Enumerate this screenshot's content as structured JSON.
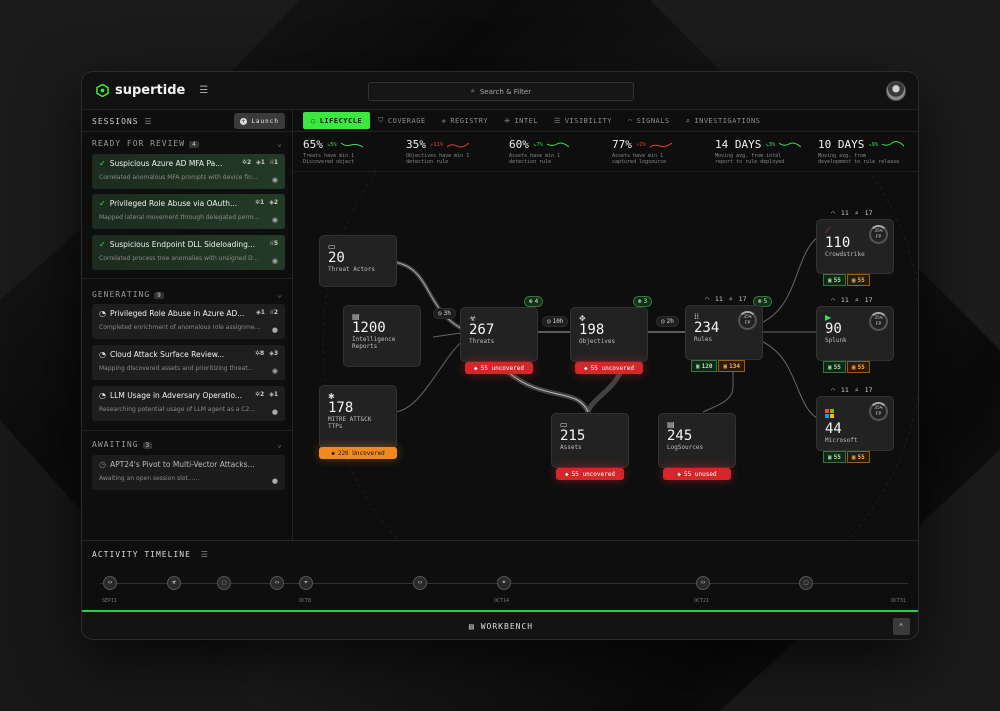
{
  "app": {
    "name": "supertide"
  },
  "search": {
    "label": "Search & Filter"
  },
  "sessions": {
    "title": "SESSIONS",
    "launch_label": "Launch"
  },
  "groups": {
    "ready": {
      "label": "READY FOR REVIEW",
      "count": "4"
    },
    "generating": {
      "label": "GENERATING",
      "count": "9"
    },
    "awaiting": {
      "label": "AWAITING",
      "count": "3"
    }
  },
  "ready_items": [
    {
      "title": "Suspicious Azure AD MFA Pa...",
      "desc": "Correlated anomalous MFA prompts with device fin...",
      "m1": "2",
      "m2": "1",
      "m3": "1"
    },
    {
      "title": "Privileged Role Abuse via OAuth...",
      "desc": "Mapped lateral movement through delegated perm...",
      "m1": "1",
      "m2": "2"
    },
    {
      "title": "Suspicious Endpoint DLL Sideloading...",
      "desc": "Correlated process tree anomalies with unsigned D...",
      "m1": "5"
    }
  ],
  "generating_items": [
    {
      "title": "Privileged Role Abuse in Azure AD...",
      "desc": "Completed enrichment of anomalous role assignme...",
      "m1": "1",
      "m2": "2"
    },
    {
      "title": "Cloud Attack Surface Review...",
      "desc": "Mapping discovered assets and prioritizing threat...",
      "m1": "8",
      "m2": "3"
    },
    {
      "title": "LLM Usage in Adversary Operatio...",
      "desc": "Researching potential usage of LLM agent as a C2...",
      "m1": "2",
      "m2": "1"
    }
  ],
  "awaiting_items": [
    {
      "title": "APT24's Pivot to Multi-Vector Attacks...",
      "desc": "Awaiting an open session slot......"
    }
  ],
  "tabs": [
    "LIFECYCLE",
    "COVERAGE",
    "REGISTRY",
    "INTEL",
    "VISIBILITY",
    "SIGNALS",
    "INVESTIGATIONS"
  ],
  "metrics": [
    {
      "value": "65%",
      "change": "5%",
      "dir": "down",
      "label1": "Treats have min 1",
      "label2": "Discovered object"
    },
    {
      "value": "35%",
      "change": "11%",
      "dir": "up",
      "label1": "Objectives have min 1",
      "label2": "detection rule"
    },
    {
      "value": "60%",
      "change": "7%",
      "dir": "down",
      "label1": "Assets have min 1",
      "label2": "detection rule"
    },
    {
      "value": "77%",
      "change": "2%",
      "dir": "up",
      "label1": "Assets have min 1",
      "label2": "captured logsource"
    },
    {
      "value": "14 DAYS",
      "change": "3%",
      "dir": "down",
      "label1": "Moving avg. from intel",
      "label2": "report to rule deployed"
    },
    {
      "value": "10 DAYS",
      "change": "9%",
      "dir": "down",
      "label1": "Moving avg. from",
      "label2": "development to rule release"
    }
  ],
  "nodes": {
    "actors": {
      "value": "20",
      "label": "Threat Actors"
    },
    "reports": {
      "value": "1200",
      "label1": "Intelligence",
      "label2": "Reports"
    },
    "ttps": {
      "value": "178",
      "label1": "MITRE ATT&CK",
      "label2": "TTPs",
      "badge": "220 Uncovered"
    },
    "threats": {
      "value": "267",
      "label": "Threats",
      "badge": "55 uncovered",
      "pill": "4"
    },
    "objectives": {
      "value": "198",
      "label": "Objectives",
      "badge": "55 uncovered",
      "pill": "3"
    },
    "rules": {
      "value": "234",
      "label": "Rules",
      "ring": "35%",
      "ring_sub": "FP",
      "wifi": "11",
      "search": "17",
      "pill": "5",
      "sub_green": "120",
      "sub_orange": "134"
    },
    "assets": {
      "value": "215",
      "label": "Assets",
      "badge": "55 uncovered"
    },
    "logs": {
      "value": "245",
      "label": "LogSources",
      "badge": "55 unused"
    },
    "crowdstrike": {
      "value": "110",
      "label": "Crowdstrike",
      "ring": "35%",
      "ring_sub": "FP",
      "wifi": "11",
      "search": "17",
      "sub_green": "55",
      "sub_orange": "55"
    },
    "splunk": {
      "value": "90",
      "label": "Splunk",
      "ring": "35%",
      "ring_sub": "FP",
      "wifi": "11",
      "search": "17",
      "sub_green": "55",
      "sub_orange": "55"
    },
    "microsoft": {
      "value": "44",
      "label": "Microsoft",
      "ring": "35%",
      "ring_sub": "FP",
      "wifi": "11",
      "search": "17",
      "sub_green": "55",
      "sub_orange": "55"
    }
  },
  "edges": {
    "e1": "3h",
    "e2": "10h",
    "e3": "2h"
  },
  "timeline": {
    "title": "ACTIVITY TIMELINE",
    "labels": [
      "SEP11",
      "OCT8",
      "OCT14",
      "OCT21",
      "OCT31"
    ]
  },
  "workbench": {
    "label": "WORKBENCH"
  },
  "colors": {
    "accent": "#3be83f",
    "danger": "#d3272a",
    "warning": "#f08a1c"
  }
}
